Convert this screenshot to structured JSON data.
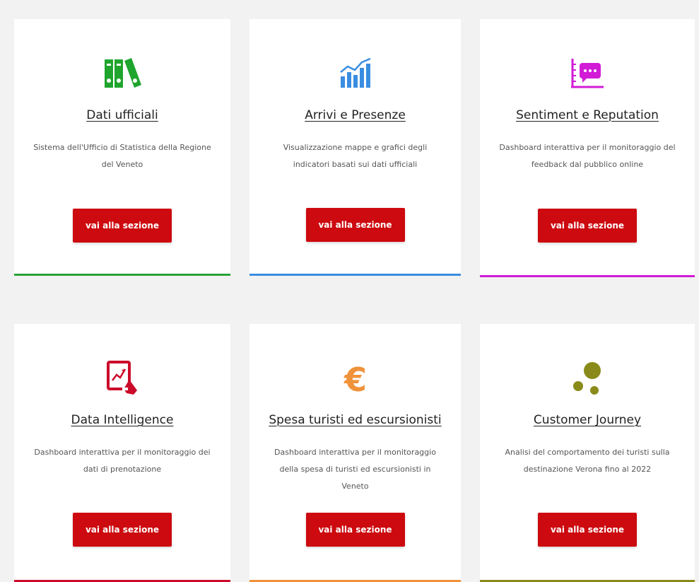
{
  "button_label": "vai alla sezione",
  "cards": [
    {
      "title": "Dati ufficiali",
      "description": "Sistema dell'Ufficio di Statistica della Regione del Veneto",
      "icon": "binders-icon",
      "accent": "#2aa33a"
    },
    {
      "title": "Arrivi e Presenze",
      "description": "Visualizzazione mappe e grafici degli indicatori basati sui dati ufficiali",
      "icon": "bar-chart-icon",
      "accent": "#3a8de0"
    },
    {
      "title": "Sentiment e Reputation",
      "description": "Dashboard interattiva per il monitoraggio del feedback dal pubblico online",
      "icon": "chat-board-icon",
      "accent": "#d21bd6"
    },
    {
      "title": "Data Intelligence",
      "description": "Dashboard interattiva per il monitoraggio dei dati di prenotazione",
      "icon": "tablet-chart-icon",
      "accent": "#cc0a2a"
    },
    {
      "title": "Spesa turisti ed escursionisti",
      "description": "Dashboard interattiva per il monitoraggio della spesa di turisti ed escursionisti in Veneto",
      "icon": "euro-icon",
      "accent": "#f0923a"
    },
    {
      "title": "Customer Journey",
      "description": "Analisi del comportamento dei turisti sulla destinazione Verona fino al 2022",
      "icon": "dots-icon",
      "accent": "#8a8a1a"
    }
  ]
}
